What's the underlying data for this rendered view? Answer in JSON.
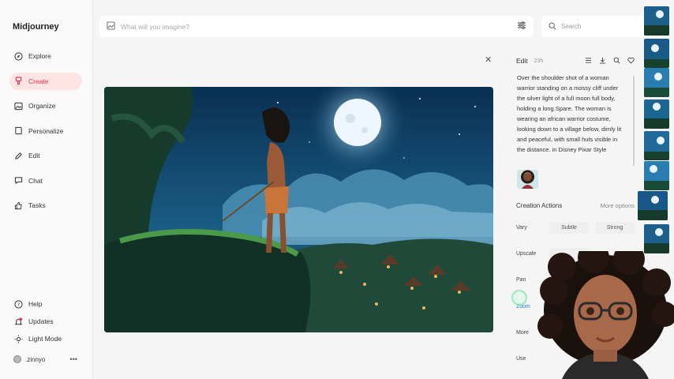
{
  "app": {
    "title": "Midjourney"
  },
  "sidebar": {
    "items": [
      {
        "label": "Explore",
        "icon": "compass-icon",
        "active": false
      },
      {
        "label": "Create",
        "icon": "brush-icon",
        "active": true
      },
      {
        "label": "Organize",
        "icon": "folder-image-icon",
        "active": false
      },
      {
        "label": "Personalize",
        "icon": "book-icon",
        "active": false
      },
      {
        "label": "Edit",
        "icon": "pencil-icon",
        "active": false
      },
      {
        "label": "Chat",
        "icon": "chat-bubble-icon",
        "active": false
      },
      {
        "label": "Tasks",
        "icon": "thumbs-up-icon",
        "active": false
      }
    ],
    "bottom": [
      {
        "label": "Help",
        "icon": "question-icon"
      },
      {
        "label": "Updates",
        "icon": "bell-icon"
      },
      {
        "label": "Light Mode",
        "icon": "sun-icon"
      }
    ],
    "user": {
      "name": ".zinnyo",
      "menu": "•••"
    }
  },
  "topbar": {
    "imagine_placeholder": "What will you imagine?",
    "search_placeholder": "Search"
  },
  "panel": {
    "edit_label": "Edit",
    "age": "23h",
    "prompt": "Over the shoulder shot of a woman warrior standing on a mossy cliff under the silver light of a full moon full body, holding a long Spare. The woman is wearing an african warrior costume, looking down to a village below, dimly lit and peaceful, with small huts visible in the distance. in Disney Pixar Style",
    "creation_actions": "Creation Actions",
    "more_options": "More options",
    "vary": {
      "label": "Vary",
      "subtle": "Subtle",
      "strong": "Strong"
    },
    "upscale": {
      "label": "Upscale"
    },
    "pan": {
      "label": "Pan"
    },
    "zoom": {
      "label": "Zoom"
    },
    "more": {
      "label": "More"
    },
    "use": {
      "label": "Use"
    }
  },
  "colors": {
    "accent": "#e0324c",
    "active_bg": "#ffe4e4",
    "night_sky": "#0e3f63",
    "moon": "#eef6ff"
  }
}
